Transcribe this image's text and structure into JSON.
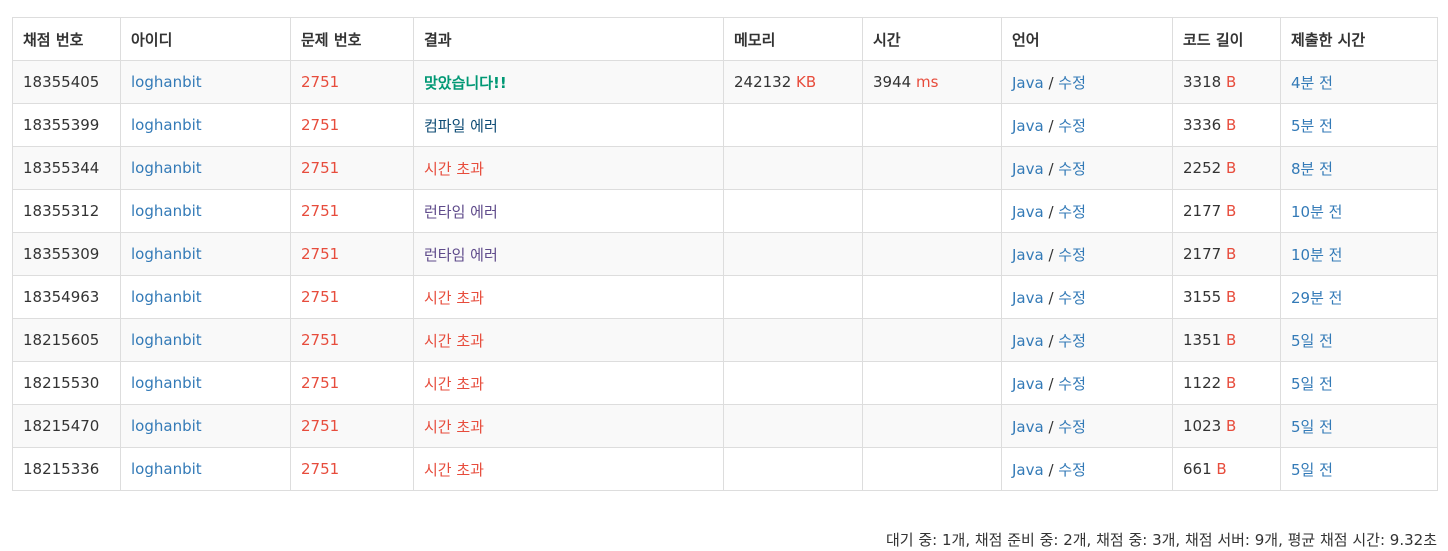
{
  "columns": [
    "채점 번호",
    "아이디",
    "문제 번호",
    "결과",
    "메모리",
    "시간",
    "언어",
    "코드 길이",
    "제출한 시간"
  ],
  "units": {
    "memory": "KB",
    "time": "ms",
    "code": "B"
  },
  "lang": {
    "name": "Java",
    "sep": "/",
    "edit": "수정"
  },
  "colors": {
    "link": "#337ab7",
    "problem": "#e74c3c",
    "accepted": "#009874",
    "time_limit": "#e74c3c",
    "compile_error": "#0f4c75",
    "runtime_error": "#5f4b8b",
    "border": "#dddddd",
    "stripe": "#f9f9f9"
  },
  "rows": [
    {
      "id": "18355405",
      "user": "loghanbit",
      "problem": "2751",
      "result": "맞았습니다!!",
      "result_type": "ac",
      "memory": "242132",
      "time": "3944",
      "code_len": "3318",
      "submitted": "4분 전"
    },
    {
      "id": "18355399",
      "user": "loghanbit",
      "problem": "2751",
      "result": "컴파일 에러",
      "result_type": "ce",
      "memory": "",
      "time": "",
      "code_len": "3336",
      "submitted": "5분 전"
    },
    {
      "id": "18355344",
      "user": "loghanbit",
      "problem": "2751",
      "result": "시간 초과",
      "result_type": "tle",
      "memory": "",
      "time": "",
      "code_len": "2252",
      "submitted": "8분 전"
    },
    {
      "id": "18355312",
      "user": "loghanbit",
      "problem": "2751",
      "result": "런타임 에러",
      "result_type": "rte",
      "memory": "",
      "time": "",
      "code_len": "2177",
      "submitted": "10분 전"
    },
    {
      "id": "18355309",
      "user": "loghanbit",
      "problem": "2751",
      "result": "런타임 에러",
      "result_type": "rte",
      "memory": "",
      "time": "",
      "code_len": "2177",
      "submitted": "10분 전"
    },
    {
      "id": "18354963",
      "user": "loghanbit",
      "problem": "2751",
      "result": "시간 초과",
      "result_type": "tle",
      "memory": "",
      "time": "",
      "code_len": "3155",
      "submitted": "29분 전"
    },
    {
      "id": "18215605",
      "user": "loghanbit",
      "problem": "2751",
      "result": "시간 초과",
      "result_type": "tle",
      "memory": "",
      "time": "",
      "code_len": "1351",
      "submitted": "5일 전"
    },
    {
      "id": "18215530",
      "user": "loghanbit",
      "problem": "2751",
      "result": "시간 초과",
      "result_type": "tle",
      "memory": "",
      "time": "",
      "code_len": "1122",
      "submitted": "5일 전"
    },
    {
      "id": "18215470",
      "user": "loghanbit",
      "problem": "2751",
      "result": "시간 초과",
      "result_type": "tle",
      "memory": "",
      "time": "",
      "code_len": "1023",
      "submitted": "5일 전"
    },
    {
      "id": "18215336",
      "user": "loghanbit",
      "problem": "2751",
      "result": "시간 초과",
      "result_type": "tle",
      "memory": "",
      "time": "",
      "code_len": "661",
      "submitted": "5일 전"
    }
  ],
  "footer": "대기 중: 1개, 채점 준비 중: 2개, 채점 중: 3개, 채점 서버: 9개, 평균 채점 시간: 9.32초"
}
